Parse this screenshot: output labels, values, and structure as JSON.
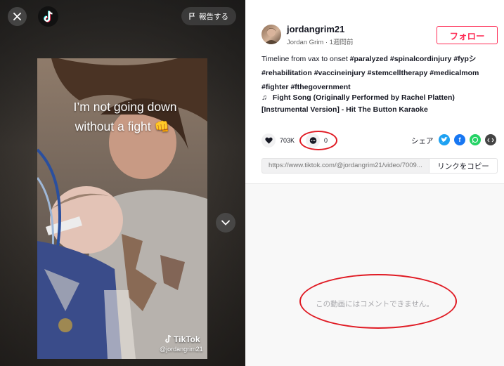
{
  "video": {
    "report_label": "報告する",
    "overlay_line1": "I’m not going down",
    "overlay_line2": "without a fight 👊",
    "watermark_brand": "TikTok",
    "watermark_user": "@jordangrim21"
  },
  "author": {
    "username": "jordangrim21",
    "meta": "Jordan Grim · 1週間前",
    "follow_label": "フォロー"
  },
  "caption": {
    "text": "Timeline from vax to onset",
    "hashtags": [
      "#paralyzed",
      "#spinalcordinjury",
      "#fypシ",
      "#rehabilitation",
      "#vaccineinjury",
      "#stemcelltherapy",
      "#medicalmom",
      "#fighter",
      "#fthegovernment"
    ]
  },
  "music": {
    "title": "Fight Song (Originally Performed by Rachel Platten) [Instrumental Version] - Hit The Button Karaoke"
  },
  "stats": {
    "likes": "703K",
    "comments": "0"
  },
  "share": {
    "label": "シェア",
    "icons": [
      "twitter-icon",
      "facebook-icon",
      "whatsapp-icon",
      "embed-icon"
    ]
  },
  "link": {
    "url": "https://www.tiktok.com/@jordangrim21/video/7009...",
    "copy_label": "リンクをコピー"
  },
  "comments": {
    "empty_text": "この動画にはコメントできません。"
  },
  "colors": {
    "accent": "#fe2c55",
    "highlight": "#e01b24",
    "twitter": "#1da1f2",
    "facebook": "#1877f2",
    "whatsapp": "#25d366",
    "embed": "#444444"
  }
}
